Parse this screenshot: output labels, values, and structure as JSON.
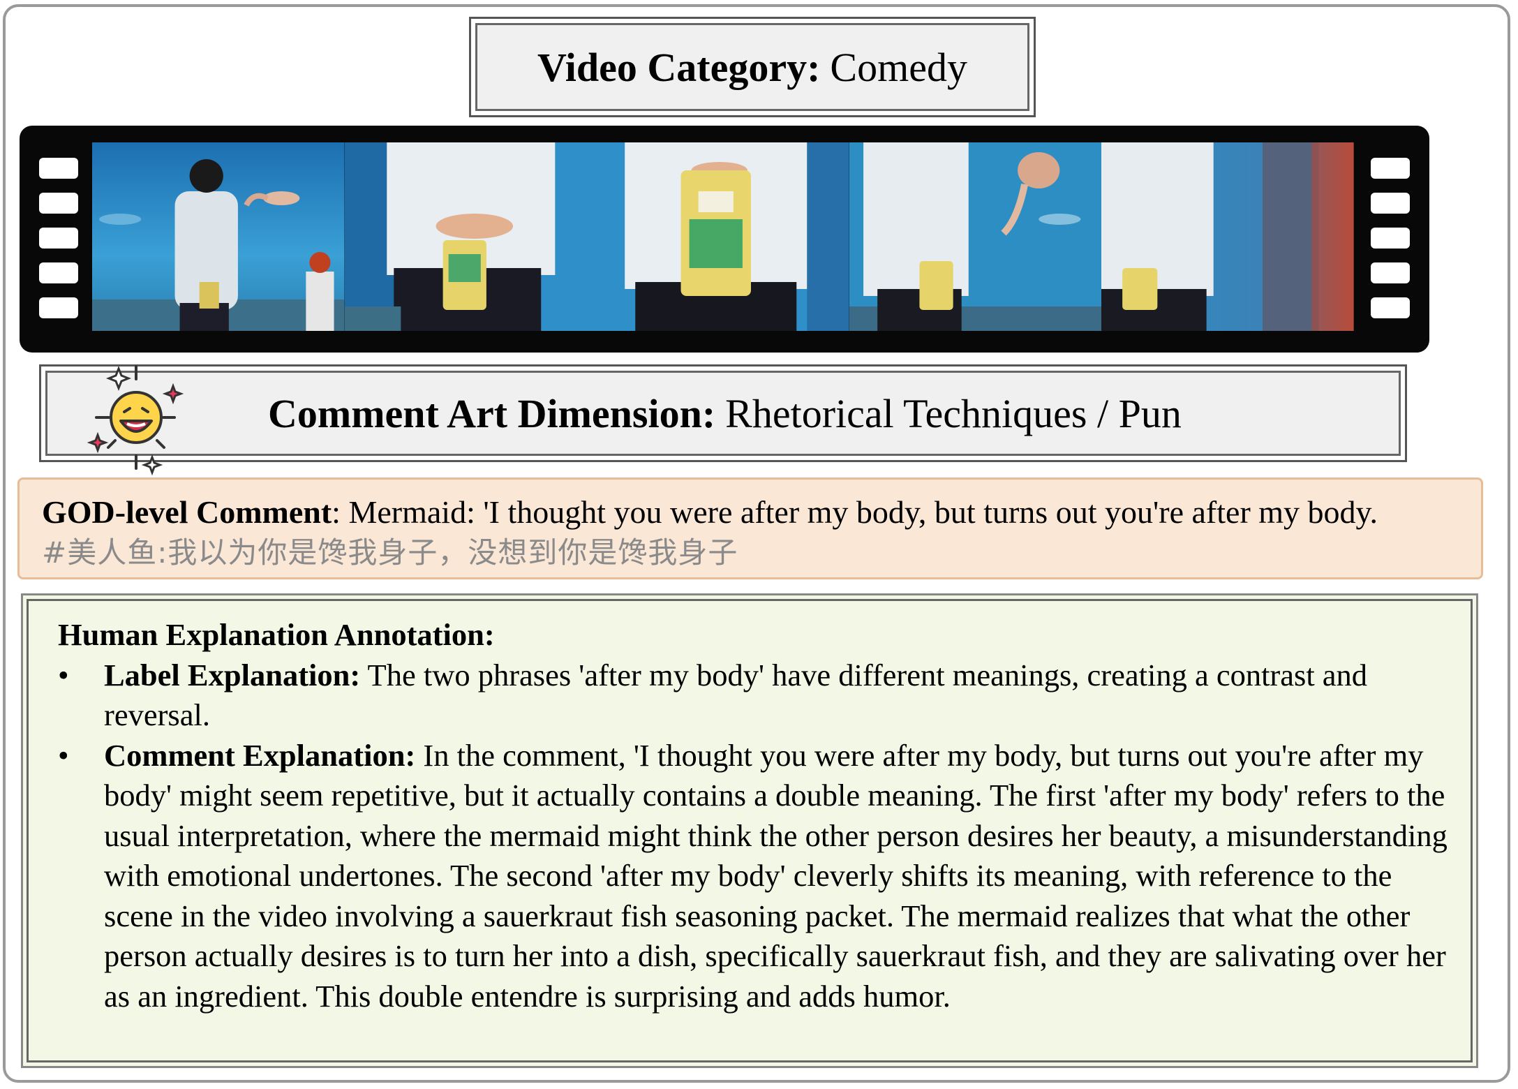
{
  "category": {
    "label": "Video Category:",
    "value": "Comedy"
  },
  "film_strip": {
    "frame_count": 5
  },
  "dimension": {
    "label": "Comment Art Dimension:",
    "value": "Rhetorical Techniques / Pun",
    "icon": "laughing-face-icon"
  },
  "god_comment": {
    "label": "GOD-level Comment",
    "text": ": Mermaid: 'I thought you were after my body, but turns out you're after my body.",
    "original": "#美人鱼:我以为你是馋我身子，没想到你是馋我身子"
  },
  "explanation": {
    "heading": "Human Explanation Annotation:",
    "items": [
      {
        "bullet": "•",
        "label": "Label Explanation:",
        "text": " The two phrases 'after my body' have different meanings, creating a contrast and reversal."
      },
      {
        "bullet": "•",
        "label": "Comment Explanation:",
        "text": " In the comment, 'I thought you were after my body, but turns out you're after my body' might seem repetitive, but it actually contains a double meaning. The first 'after my body' refers to the usual interpretation, where the mermaid might think the other person desires her beauty, a misunderstanding with emotional undertones. The second 'after my body' cleverly shifts its meaning, with reference to the scene in the video involving a sauerkraut fish seasoning packet. The mermaid realizes that what the other person actually desires is to turn her into a dish, specifically sauerkraut fish, and they are salivating over her as an ingredient. This double entendre is surprising and adds humor."
      }
    ]
  },
  "colors": {
    "god_bg": "#fae7d6",
    "explain_bg": "#f3f8e6",
    "film": "#080808",
    "aquarium": "#2f8fc8"
  }
}
